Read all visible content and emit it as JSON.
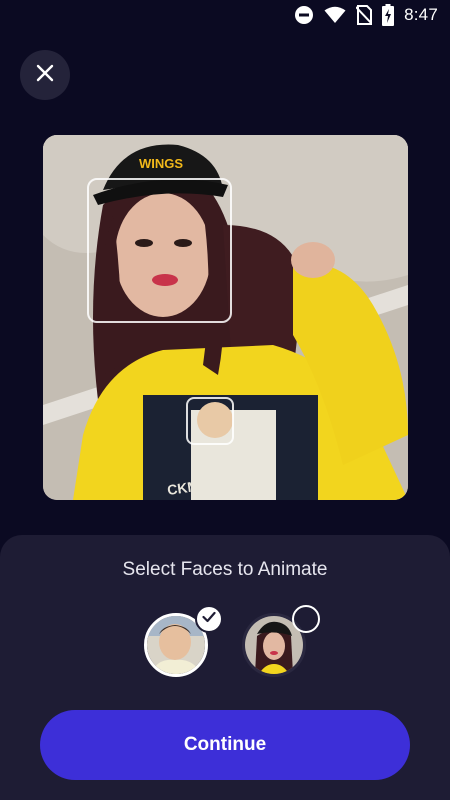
{
  "status_bar": {
    "time": "8:47",
    "icons": [
      "do-not-disturb-icon",
      "wifi-icon",
      "no-sim-icon",
      "battery-charging-icon"
    ]
  },
  "header": {
    "close_icon": "close-icon"
  },
  "photo": {
    "cap_text": "WINGS",
    "shirt_text": "CKMAN"
  },
  "sheet": {
    "title": "Select Faces to Animate",
    "faces": [
      {
        "name": "face-older-man",
        "selected": true
      },
      {
        "name": "face-woman-cap",
        "selected": false
      }
    ],
    "continue_label": "Continue"
  },
  "colors": {
    "background": "#0b0a22",
    "sheet": "#1e1c34",
    "accent": "#3d2fd8",
    "close_button": "#24233a"
  }
}
